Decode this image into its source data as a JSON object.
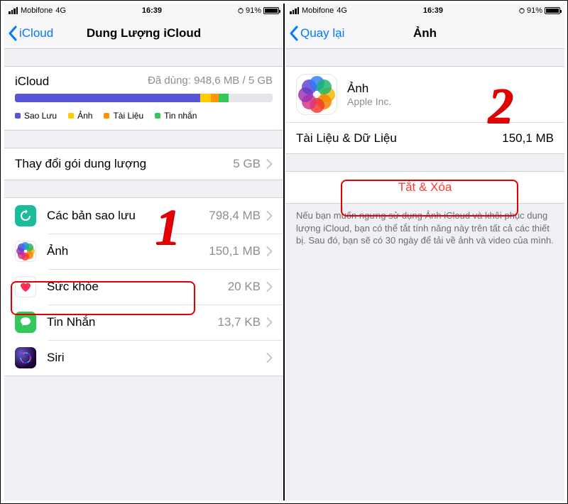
{
  "status": {
    "carrier": "Mobifone",
    "net": "4G",
    "time": "16:39",
    "battery": "91%"
  },
  "left": {
    "back_label": "iCloud",
    "title": "Dung Lượng iCloud",
    "storage": {
      "title": "iCloud",
      "usage": "Đã dùng: 948,6 MB / 5 GB",
      "segments": [
        {
          "color": "#5856d6",
          "width": "72%"
        },
        {
          "color": "#ffcc00",
          "width": "4%"
        },
        {
          "color": "#ff9500",
          "width": "3%"
        },
        {
          "color": "#34c759",
          "width": "4%"
        }
      ],
      "legend": [
        {
          "color": "#5856d6",
          "label": "Sao Lưu"
        },
        {
          "color": "#ffcc00",
          "label": "Ảnh"
        },
        {
          "color": "#ff9500",
          "label": "Tài Liệu"
        },
        {
          "color": "#34c759",
          "label": "Tin nhắn"
        }
      ]
    },
    "plan": {
      "label": "Thay đổi gói dung lượng",
      "value": "5 GB"
    },
    "items": [
      {
        "icon": "backup",
        "label": "Các bản sao lưu",
        "value": "798,4 MB"
      },
      {
        "icon": "photos",
        "label": "Ảnh",
        "value": "150,1 MB"
      },
      {
        "icon": "health",
        "label": "Sức khỏe",
        "value": "20 KB"
      },
      {
        "icon": "messages",
        "label": "Tin Nhắn",
        "value": "13,7 KB"
      },
      {
        "icon": "siri",
        "label": "Siri",
        "value": ""
      }
    ]
  },
  "right": {
    "back_label": "Quay lại",
    "title": "Ảnh",
    "app": {
      "name": "Ảnh",
      "vendor": "Apple Inc."
    },
    "data": {
      "label": "Tài Liệu & Dữ Liệu",
      "value": "150,1 MB"
    },
    "action": "Tắt & Xóa",
    "footer": "Nếu bạn muốn ngưng sử dụng Ảnh iCloud và khôi phục dung lượng iCloud, bạn có thể tắt tính năng này trên tất cả các thiết bị. Sau đó, bạn sẽ có 30 ngày để tải về ảnh và video của mình."
  },
  "annot": {
    "one": "1",
    "two": "2"
  }
}
